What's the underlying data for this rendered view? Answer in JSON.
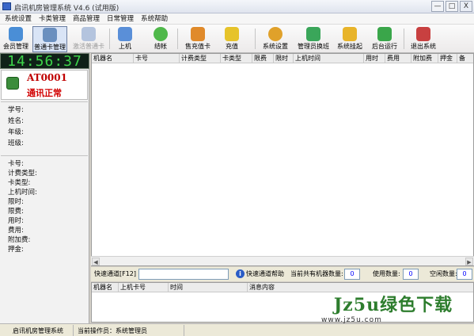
{
  "window": {
    "title": "启讯机房管理系统  V4.6  (试用版)",
    "min": "—",
    "max": "□",
    "close": "X"
  },
  "menu": [
    "系统设置",
    "卡类管理",
    "商品管理",
    "日常管理",
    "系统帮助"
  ],
  "toolbar": [
    {
      "label": "会员管理",
      "icon": "members-icon",
      "color": "#4a8ed6"
    },
    {
      "label": "普通卡管理",
      "icon": "card-manage-icon",
      "color": "#6a8fbf"
    },
    {
      "label": "激活普通卡",
      "icon": "activate-card-icon",
      "color": "#8aa6d8"
    },
    {
      "label": "上机",
      "icon": "computer-icon",
      "color": "#5a8fd8"
    },
    {
      "label": "结帐",
      "icon": "checkout-icon",
      "color": "#4fb84a"
    },
    {
      "label": "售充值卡",
      "icon": "sell-card-icon",
      "color": "#e08a2a"
    },
    {
      "label": "充值",
      "icon": "recharge-icon",
      "color": "#e6c32a"
    },
    {
      "label": "系统设置",
      "icon": "gear-icon",
      "color": "#e0a12a"
    },
    {
      "label": "管理员换班",
      "icon": "shift-icon",
      "color": "#3aa65a"
    },
    {
      "label": "系统挂起",
      "icon": "lock-icon",
      "color": "#e8b42a"
    },
    {
      "label": "后台运行",
      "icon": "background-icon",
      "color": "#3aa64a"
    },
    {
      "label": "退出系统",
      "icon": "exit-icon",
      "color": "#c84040"
    }
  ],
  "clock": "14:56:37",
  "status": {
    "machine_id": "AT0001",
    "text": "通讯正常"
  },
  "student_fields": [
    "学号:",
    "姓名:",
    "年级:",
    "班级:"
  ],
  "card_fields": [
    "卡号:",
    "计费类型:",
    "卡类型:",
    "上机时间:",
    "限时:",
    "限费:",
    "用时:",
    "费用:",
    "附加费:",
    "押金:"
  ],
  "grid_columns": [
    "机器名",
    "卡号",
    "计费类型",
    "卡类型",
    "限费",
    "限时",
    "上机时间",
    "用时",
    "费用",
    "附加费",
    "押金",
    "备"
  ],
  "bottom": {
    "channel_label": "快速通道[F12]",
    "channel_value": "",
    "help_label": "快速通道帮助",
    "info_icon": "i",
    "total_label": "当前共有机器数量:",
    "total_value": "0",
    "used_label": "使用数量:",
    "used_value": "0",
    "idle_label": "空闲数量:",
    "idle_value": "0"
  },
  "msg_columns": [
    "机器名",
    "上机卡号",
    "时间",
    "消息内容"
  ],
  "statusbar": {
    "app": "启讯机房管理系统",
    "operator": "当前操作员：系统管理员"
  },
  "watermark": {
    "title": "Jz5u绿色下载",
    "url": "www.jz5u.com"
  }
}
